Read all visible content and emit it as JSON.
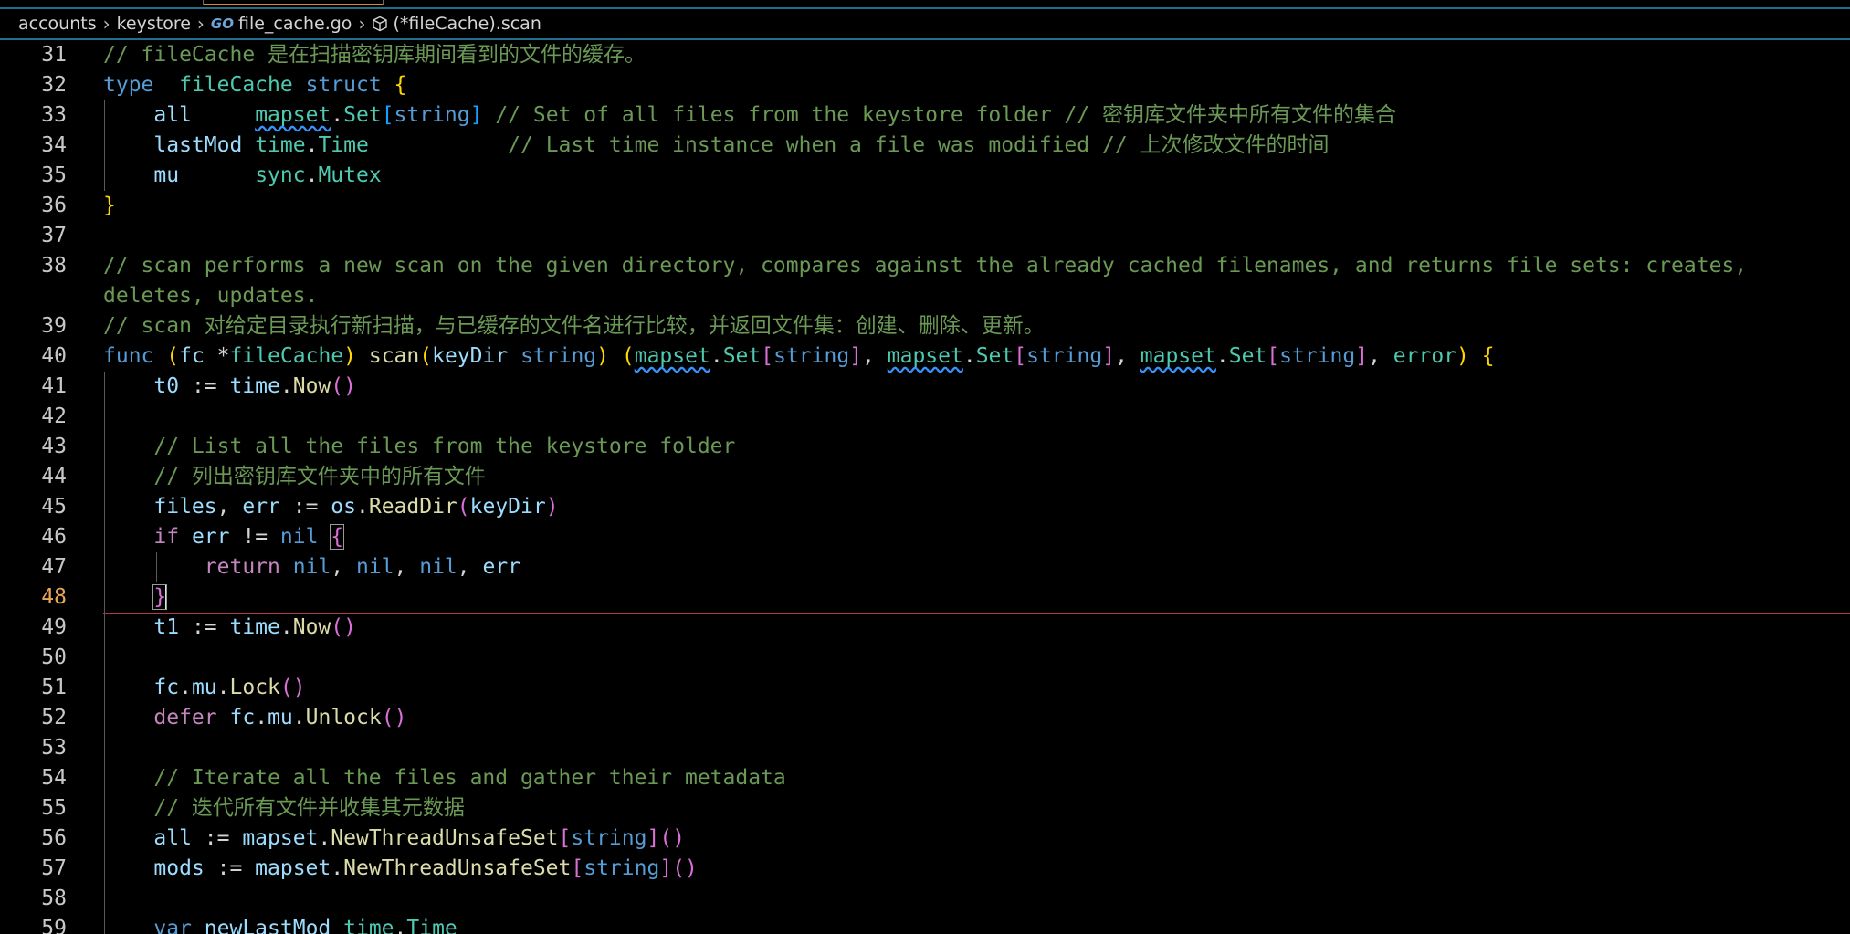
{
  "breadcrumb": {
    "items": [
      "accounts",
      "keystore",
      "file_cache.go",
      "(*fileCache).scan"
    ],
    "go_icon_text": "GO"
  },
  "editor": {
    "active_line": 48,
    "lines": [
      {
        "n": "31",
        "tokens": [
          [
            "cm",
            "// fileCache 是在扫描密钥库期间看到的文件的缓存。"
          ]
        ]
      },
      {
        "n": "32",
        "tokens": [
          [
            "kw",
            "type"
          ],
          [
            "",
            "  "
          ],
          [
            "ty",
            "fileCache"
          ],
          [
            "",
            " "
          ],
          [
            "kw",
            "struct"
          ],
          [
            "",
            " "
          ],
          [
            "p1",
            "{"
          ]
        ]
      },
      {
        "n": "33",
        "indent": 1,
        "tokens": [
          [
            "id",
            "all"
          ],
          [
            "",
            "     "
          ],
          [
            "ty sq",
            "mapset"
          ],
          [
            "",
            "."
          ],
          [
            "ty",
            "Set"
          ],
          [
            "p3",
            "["
          ],
          [
            "kw",
            "string"
          ],
          [
            "p3",
            "]"
          ],
          [
            "",
            " "
          ],
          [
            "cm",
            "// Set of all files from the keystore folder // 密钥库文件夹中所有文件的集合"
          ]
        ]
      },
      {
        "n": "34",
        "indent": 1,
        "tokens": [
          [
            "id",
            "lastMod"
          ],
          [
            "",
            " "
          ],
          [
            "ty",
            "time"
          ],
          [
            "",
            "."
          ],
          [
            "ty",
            "Time"
          ],
          [
            "",
            "           "
          ],
          [
            "cm",
            "// Last time instance when a file was modified // 上次修改文件的时间"
          ]
        ]
      },
      {
        "n": "35",
        "indent": 1,
        "tokens": [
          [
            "id",
            "mu"
          ],
          [
            "",
            "      "
          ],
          [
            "ty",
            "sync"
          ],
          [
            "",
            "."
          ],
          [
            "ty",
            "Mutex"
          ]
        ]
      },
      {
        "n": "36",
        "tokens": [
          [
            "p1",
            "}"
          ]
        ]
      },
      {
        "n": "37",
        "tokens": []
      },
      {
        "n": "38",
        "wrap": true,
        "tokens": [
          [
            "cm",
            "// scan performs a new scan on the given directory, compares against the already cached filenames, and returns file sets: creates, deletes, updates."
          ]
        ]
      },
      {
        "n": "39",
        "tokens": [
          [
            "cm",
            "// scan 对给定目录执行新扫描，与已缓存的文件名进行比较，并返回文件集：创建、删除、更新。"
          ]
        ]
      },
      {
        "n": "40",
        "tokens": [
          [
            "kw",
            "func"
          ],
          [
            "",
            " "
          ],
          [
            "p1",
            "("
          ],
          [
            "id",
            "fc"
          ],
          [
            "",
            " *"
          ],
          [
            "ty",
            "fileCache"
          ],
          [
            "p1",
            ")"
          ],
          [
            "",
            " "
          ],
          [
            "fn",
            "scan"
          ],
          [
            "p1",
            "("
          ],
          [
            "id",
            "keyDir"
          ],
          [
            "",
            " "
          ],
          [
            "kw",
            "string"
          ],
          [
            "p1",
            ")"
          ],
          [
            "",
            " "
          ],
          [
            "p1",
            "("
          ],
          [
            "ty sq",
            "mapset"
          ],
          [
            "",
            "."
          ],
          [
            "ty",
            "Set"
          ],
          [
            "p2",
            "["
          ],
          [
            "kw",
            "string"
          ],
          [
            "p2",
            "]"
          ],
          [
            ", ",
            ""
          ],
          [
            "ty sq",
            "mapset"
          ],
          [
            "",
            "."
          ],
          [
            "ty",
            "Set"
          ],
          [
            "p2",
            "["
          ],
          [
            "kw",
            "string"
          ],
          [
            "p2",
            "]"
          ],
          [
            ", ",
            ""
          ],
          [
            "ty sq",
            "mapset"
          ],
          [
            "",
            "."
          ],
          [
            "ty",
            "Set"
          ],
          [
            "p2",
            "["
          ],
          [
            "kw",
            "string"
          ],
          [
            "p2",
            "]"
          ],
          [
            ", ",
            ""
          ],
          [
            "ty",
            "error"
          ],
          [
            "p1",
            ")"
          ],
          [
            "",
            " "
          ],
          [
            "p1",
            "{"
          ]
        ]
      },
      {
        "n": "41",
        "indent": 1,
        "tokens": [
          [
            "id",
            "t0"
          ],
          [
            "",
            " := "
          ],
          [
            "id",
            "time"
          ],
          [
            "",
            "."
          ],
          [
            "fn",
            "Now"
          ],
          [
            "p2",
            "()"
          ]
        ]
      },
      {
        "n": "42",
        "indent": 1,
        "tokens": []
      },
      {
        "n": "43",
        "indent": 1,
        "tokens": [
          [
            "cm",
            "// List all the files from the keystore folder"
          ]
        ]
      },
      {
        "n": "44",
        "indent": 1,
        "tokens": [
          [
            "cm",
            "// 列出密钥库文件夹中的所有文件"
          ]
        ]
      },
      {
        "n": "45",
        "indent": 1,
        "tokens": [
          [
            "id",
            "files"
          ],
          [
            "",
            ", "
          ],
          [
            "id",
            "err"
          ],
          [
            "",
            " := "
          ],
          [
            "id",
            "os"
          ],
          [
            "",
            "."
          ],
          [
            "fn",
            "ReadDir"
          ],
          [
            "p2",
            "("
          ],
          [
            "id",
            "keyDir"
          ],
          [
            "p2",
            ")"
          ]
        ]
      },
      {
        "n": "46",
        "indent": 1,
        "tokens": [
          [
            "kc",
            "if"
          ],
          [
            "",
            " "
          ],
          [
            "id",
            "err"
          ],
          [
            "",
            " != "
          ],
          [
            "kw",
            "nil"
          ],
          [
            "",
            " "
          ],
          [
            "p2 brace",
            "{"
          ]
        ]
      },
      {
        "n": "47",
        "indent": 2,
        "tokens": [
          [
            "kc",
            "return"
          ],
          [
            "",
            " "
          ],
          [
            "kw",
            "nil"
          ],
          [
            "",
            ", "
          ],
          [
            "kw",
            "nil"
          ],
          [
            "",
            ", "
          ],
          [
            "kw",
            "nil"
          ],
          [
            "",
            ", "
          ],
          [
            "id",
            "err"
          ]
        ]
      },
      {
        "n": "48",
        "indent": 1,
        "active": true,
        "tokens": [
          [
            "p2 brace",
            "}"
          ]
        ]
      },
      {
        "n": "49",
        "indent": 1,
        "tokens": [
          [
            "id",
            "t1"
          ],
          [
            "",
            " := "
          ],
          [
            "id",
            "time"
          ],
          [
            "",
            "."
          ],
          [
            "fn",
            "Now"
          ],
          [
            "p2",
            "()"
          ]
        ]
      },
      {
        "n": "50",
        "indent": 1,
        "tokens": []
      },
      {
        "n": "51",
        "indent": 1,
        "tokens": [
          [
            "id",
            "fc"
          ],
          [
            "",
            "."
          ],
          [
            "id",
            "mu"
          ],
          [
            "",
            "."
          ],
          [
            "fn",
            "Lock"
          ],
          [
            "p2",
            "()"
          ]
        ]
      },
      {
        "n": "52",
        "indent": 1,
        "tokens": [
          [
            "kc",
            "defer"
          ],
          [
            "",
            " "
          ],
          [
            "id",
            "fc"
          ],
          [
            "",
            "."
          ],
          [
            "id",
            "mu"
          ],
          [
            "",
            "."
          ],
          [
            "fn",
            "Unlock"
          ],
          [
            "p2",
            "()"
          ]
        ]
      },
      {
        "n": "53",
        "indent": 1,
        "tokens": []
      },
      {
        "n": "54",
        "indent": 1,
        "tokens": [
          [
            "cm",
            "// Iterate all the files and gather their metadata"
          ]
        ]
      },
      {
        "n": "55",
        "indent": 1,
        "tokens": [
          [
            "cm",
            "// 迭代所有文件并收集其元数据"
          ]
        ]
      },
      {
        "n": "56",
        "indent": 1,
        "tokens": [
          [
            "id",
            "all"
          ],
          [
            "",
            " := "
          ],
          [
            "id",
            "mapset"
          ],
          [
            "",
            "."
          ],
          [
            "fn",
            "NewThreadUnsafeSet"
          ],
          [
            "p2",
            "["
          ],
          [
            "kw",
            "string"
          ],
          [
            "p2",
            "]"
          ],
          [
            "p2",
            "()"
          ]
        ]
      },
      {
        "n": "57",
        "indent": 1,
        "tokens": [
          [
            "id",
            "mods"
          ],
          [
            "",
            " := "
          ],
          [
            "id",
            "mapset"
          ],
          [
            "",
            "."
          ],
          [
            "fn",
            "NewThreadUnsafeSet"
          ],
          [
            "p2",
            "["
          ],
          [
            "kw",
            "string"
          ],
          [
            "p2",
            "]"
          ],
          [
            "p2",
            "()"
          ]
        ]
      },
      {
        "n": "58",
        "indent": 1,
        "tokens": []
      },
      {
        "n": "59",
        "indent": 1,
        "tokens": [
          [
            "kw",
            "var"
          ],
          [
            "",
            " "
          ],
          [
            "id",
            "newLastMod"
          ],
          [
            "",
            " "
          ],
          [
            "ty",
            "time"
          ],
          [
            "",
            "."
          ],
          [
            "ty",
            "Time"
          ]
        ]
      }
    ]
  }
}
